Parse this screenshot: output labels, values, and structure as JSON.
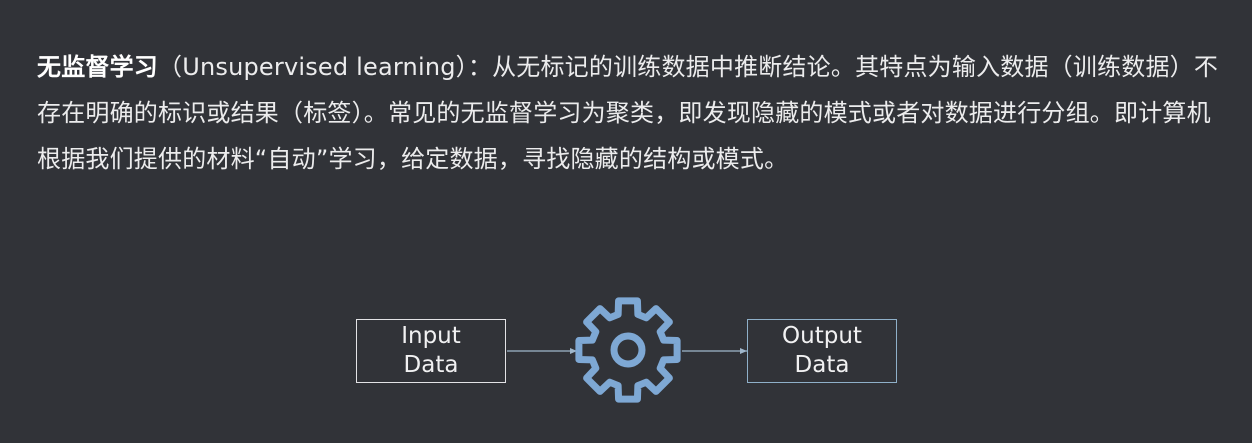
{
  "description": {
    "term": "无监督学习",
    "body": "（Unsupervised learning）：从无标记的训练数据中推断结论。其特点为输入数据（训练数据）不存在明确的标识或结果（标签）。常见的无监督学习为聚类，即发现隐藏的模式或者对数据进行分组。即计算机根据我们提供的材料“自动”学习，给定数据，寻找隐藏的结构或模式。"
  },
  "diagram": {
    "input_label": "Input\nData",
    "output_label": "Output\nData",
    "process_icon": "gear-icon",
    "colors": {
      "gear": "#7ea8d4",
      "arrow": "#9fb7cc",
      "output_border": "#8fb0c9",
      "input_border": "#e3e3e6",
      "background": "#313338"
    }
  }
}
